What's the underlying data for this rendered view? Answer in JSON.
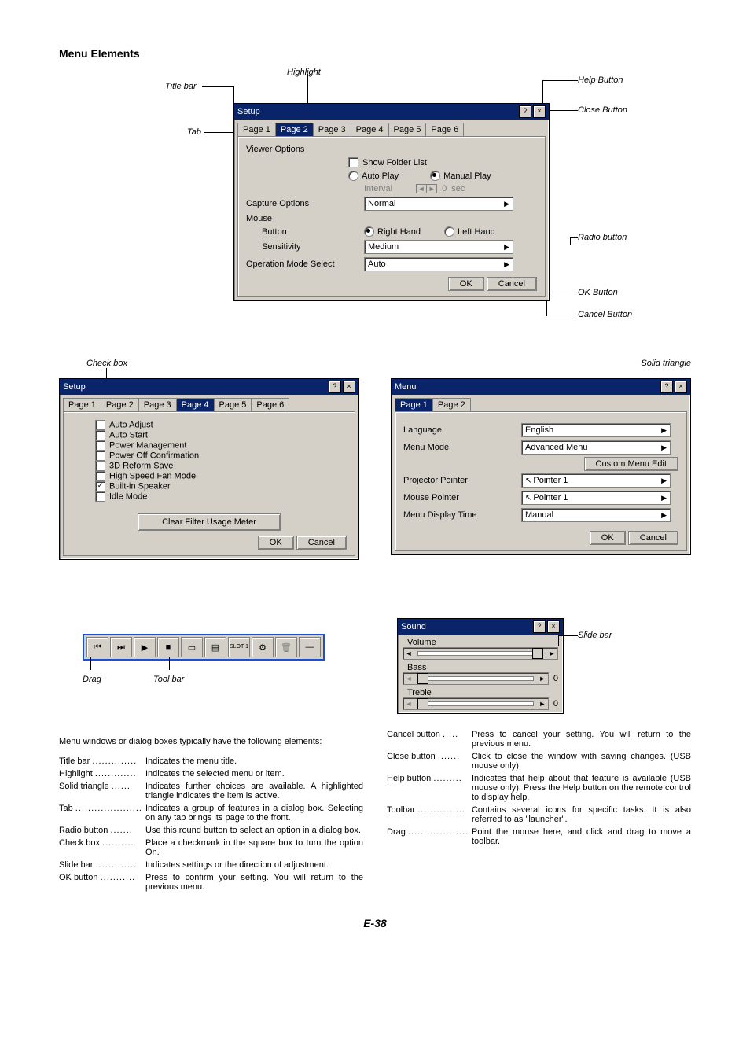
{
  "page": {
    "section_title": "Menu Elements",
    "footer": "E-38"
  },
  "annotations": {
    "title_bar": "Title bar",
    "highlight": "Highlight",
    "help_button": "Help Button",
    "close_button": "Close Button",
    "tab": "Tab",
    "radio_button": "Radio button",
    "ok_button": "OK Button",
    "cancel_button": "Cancel Button",
    "check_box": "Check box",
    "solid_triangle": "Solid triangle",
    "slide_bar": "Slide bar",
    "drag": "Drag",
    "tool_bar": "Tool bar"
  },
  "dialog1": {
    "title": "Setup",
    "tabs": [
      "Page 1",
      "Page 2",
      "Page 3",
      "Page 4",
      "Page 5",
      "Page 6"
    ],
    "selected_tab": "Page 2",
    "viewer_options_label": "Viewer Options",
    "show_folder_list": "Show Folder List",
    "auto_play": "Auto Play",
    "manual_play": "Manual Play",
    "interval": "Interval",
    "interval_val": "0",
    "interval_unit": "sec",
    "capture_options_label": "Capture Options",
    "capture_value": "Normal",
    "mouse_label": "Mouse",
    "button_label": "Button",
    "right_hand": "Right Hand",
    "left_hand": "Left Hand",
    "sensitivity_label": "Sensitivity",
    "sensitivity_value": "Medium",
    "op_mode_label": "Operation Mode Select",
    "op_mode_value": "Auto",
    "ok": "OK",
    "cancel": "Cancel"
  },
  "dialog2": {
    "title": "Setup",
    "tabs": [
      "Page 1",
      "Page 2",
      "Page 3",
      "Page 4",
      "Page 5",
      "Page 6"
    ],
    "selected_tab": "Page 4",
    "items": {
      "auto_adjust": "Auto Adjust",
      "auto_start": "Auto Start",
      "power_management": "Power Management",
      "power_off_confirmation": "Power Off Confirmation",
      "reform_save": "3D Reform Save",
      "high_speed_fan": "High Speed Fan Mode",
      "built_in_speaker": "Built-in Speaker",
      "idle_mode": "Idle Mode"
    },
    "clear_filter": "Clear Filter Usage Meter",
    "ok": "OK",
    "cancel": "Cancel"
  },
  "dialog3": {
    "title": "Menu",
    "tabs": [
      "Page 1",
      "Page 2"
    ],
    "selected_tab": "Page 1",
    "language_label": "Language",
    "language_value": "English",
    "menu_mode_label": "Menu Mode",
    "menu_mode_value": "Advanced Menu",
    "custom_menu_edit": "Custom Menu Edit",
    "projector_pointer_label": "Projector Pointer",
    "projector_pointer_value": "Pointer 1",
    "mouse_pointer_label": "Mouse Pointer",
    "mouse_pointer_value": "Pointer 1",
    "menu_display_time_label": "Menu Display Time",
    "menu_display_time_value": "Manual",
    "ok": "OK",
    "cancel": "Cancel"
  },
  "toolbar": {
    "slot": "SLOT 1"
  },
  "sound": {
    "title": "Sound",
    "volume": "Volume",
    "bass": "Bass",
    "treble": "Treble",
    "zero": "0"
  },
  "intro": "Menu windows or dialog boxes typically have the following elements:",
  "defs_left": [
    {
      "term": "Title bar",
      "dots": "..............",
      "desc": "Indicates the menu title."
    },
    {
      "term": "Highlight",
      "dots": ".............",
      "desc": "Indicates the selected menu or item."
    },
    {
      "term": "Solid triangle",
      "dots": "......",
      "desc": "Indicates further choices are available. A highlighted triangle indicates the item is active."
    },
    {
      "term": "Tab",
      "dots": ".....................",
      "desc": "Indicates a group of features in a dialog box. Selecting on any tab brings its page to the front."
    },
    {
      "term": "Radio button",
      "dots": ".......",
      "desc": "Use this round button to select an option in a dialog box."
    },
    {
      "term": "Check box",
      "dots": "..........",
      "desc": "Place a checkmark in the square box to turn the option On."
    },
    {
      "term": "Slide bar",
      "dots": ".............",
      "desc": "Indicates settings or the direction of adjustment."
    },
    {
      "term": "OK button",
      "dots": "...........",
      "desc": "Press to confirm your setting. You will return to the previous menu."
    }
  ],
  "defs_right": [
    {
      "term": "Cancel button",
      "dots": ".....",
      "desc": "Press to cancel your setting. You will return to the previous menu."
    },
    {
      "term": "Close button",
      "dots": ".......",
      "desc": "Click to close the window with saving changes. (USB mouse only)"
    },
    {
      "term": "Help button",
      "dots": ".........",
      "desc": "Indicates that help about that feature is available (USB mouse only). Press the Help button on the remote control to display help."
    },
    {
      "term": "Toolbar",
      "dots": "...............",
      "desc": "Contains several icons for specific tasks. It is also referred to as \"launcher\"."
    },
    {
      "term": "Drag",
      "dots": "...................",
      "desc": "Point the mouse here, and click and drag to move a toolbar."
    }
  ]
}
